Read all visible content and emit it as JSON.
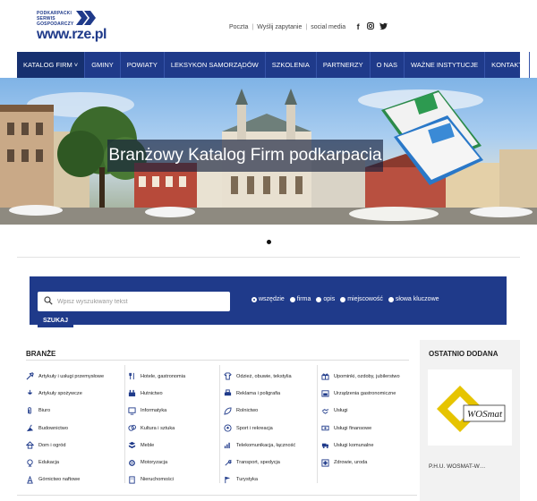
{
  "logo": {
    "line1": "PODKARPACKI",
    "line2": "SERWIS",
    "line3": "GOSPODARCZY",
    "main": "www.rze.pl"
  },
  "toplinks": {
    "poczta": "Poczta",
    "zapytanie": "Wyślij zapytanie",
    "social_label": "social media",
    "facebook": "f",
    "instagram": "◻",
    "twitter": "t"
  },
  "nav": [
    {
      "label": "KATALOG FIRM ˅"
    },
    {
      "label": "GMINY"
    },
    {
      "label": "POWIATY"
    },
    {
      "label": "LEKSYKON SAMORZĄDÓW"
    },
    {
      "label": "SZKOLENIA"
    },
    {
      "label": "PARTNERZY"
    },
    {
      "label": "O NAS"
    },
    {
      "label": "WAŻNE INSTYTUCJE"
    },
    {
      "label": "KONTAKT"
    }
  ],
  "hero": {
    "title": "Branżowy Katalog Firm podkarpacia"
  },
  "search": {
    "placeholder": "Wpisz wyszukiwany tekst",
    "options": [
      "wszędzie",
      "firma",
      "opis",
      "miejscowość",
      "słowa kluczowe"
    ],
    "selected": "wszędzie",
    "button": "SZUKAJ"
  },
  "branze": {
    "title": "BRANŻE",
    "columns": [
      [
        "Artykuły i usługi przemysłowe",
        "Artykuły spożywcze",
        "Biuro",
        "Budownictwo",
        "Dom i ogród",
        "Edukacja",
        "Górnictwo naftowe"
      ],
      [
        "Hotele, gastronomia",
        "Hutnictwo",
        "Informatyka",
        "Kultura i sztuka",
        "Meble",
        "Motoryzacja",
        "Nieruchomości"
      ],
      [
        "Odzież, obuwie, tekstylia",
        "Reklama i poligrafia",
        "Rolnictwo",
        "Sport i rekreacja",
        "Telekomunikacja, łączność",
        "Transport, spedycja",
        "Turystyka"
      ],
      [
        "Upominki, ozdoby, jubilerstwo",
        "Urządzenia gastronomiczne",
        "Usługi",
        "Usługi finansowe",
        "Usługi komunalne",
        "Zdrowie, uroda"
      ]
    ]
  },
  "recent": {
    "title": "OSTATNIO DODANA",
    "logo_text": "WOSmat",
    "name": "P.H.U. WOSMAT-W…"
  },
  "colors": {
    "brand": "#1f3a8a",
    "accent_yellow": "#e6c400"
  }
}
